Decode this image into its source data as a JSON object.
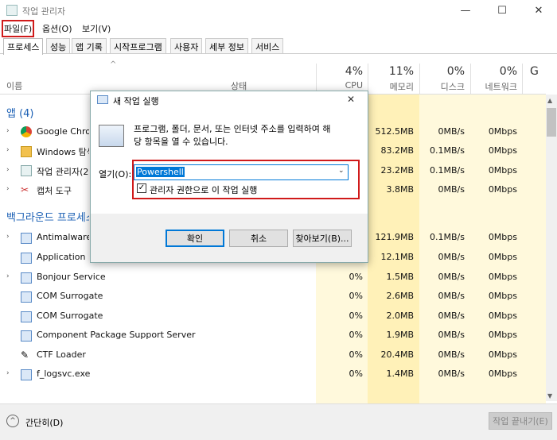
{
  "window": {
    "title": "작업 관리자",
    "minimize": "—",
    "maximize": "☐",
    "close": "✕"
  },
  "menu": [
    "파일(F)",
    "옵션(O)",
    "보기(V)"
  ],
  "tabs": [
    "프로세스",
    "성능",
    "앱 기록",
    "시작프로그램",
    "사용자",
    "세부 정보",
    "서비스"
  ],
  "columns": {
    "name": "이름",
    "status": "상태",
    "cpu_pct": "4%",
    "cpu_label": "CPU",
    "mem_pct": "11%",
    "mem_label": "메모리",
    "disk_pct": "0%",
    "disk_label": "디스크",
    "net_pct": "0%",
    "net_label": "네트워크",
    "gpu_pct": "G"
  },
  "groups": {
    "apps": "앱 (4)",
    "background": "백그라운드 프로세스"
  },
  "rows": [
    {
      "name": "Google Chrome",
      "cpu": "",
      "mem": "512.5MB",
      "disk": "0MB/s",
      "net": "0Mbps"
    },
    {
      "name": "Windows 탐색기",
      "cpu": "",
      "mem": "83.2MB",
      "disk": "0.1MB/s",
      "net": "0Mbps"
    },
    {
      "name": "작업 관리자(2)",
      "cpu": "",
      "mem": "23.2MB",
      "disk": "0.1MB/s",
      "net": "0Mbps"
    },
    {
      "name": "캡처 도구",
      "cpu": "",
      "mem": "3.8MB",
      "disk": "0MB/s",
      "net": "0Mbps"
    },
    {
      "name": "Antimalware Service Executable",
      "cpu": "",
      "mem": "121.9MB",
      "disk": "0.1MB/s",
      "net": "0Mbps"
    },
    {
      "name": "Application Frame Host",
      "cpu": "",
      "mem": "12.1MB",
      "disk": "0MB/s",
      "net": "0Mbps"
    },
    {
      "name": "Bonjour Service",
      "cpu": "0%",
      "mem": "1.5MB",
      "disk": "0MB/s",
      "net": "0Mbps"
    },
    {
      "name": "COM Surrogate",
      "cpu": "0%",
      "mem": "2.6MB",
      "disk": "0MB/s",
      "net": "0Mbps"
    },
    {
      "name": "COM Surrogate",
      "cpu": "0%",
      "mem": "2.0MB",
      "disk": "0MB/s",
      "net": "0Mbps"
    },
    {
      "name": "Component Package Support Server",
      "cpu": "0%",
      "mem": "1.9MB",
      "disk": "0MB/s",
      "net": "0Mbps"
    },
    {
      "name": "CTF Loader",
      "cpu": "0%",
      "mem": "20.4MB",
      "disk": "0MB/s",
      "net": "0Mbps"
    },
    {
      "name": "f_logsvc.exe",
      "cpu": "0%",
      "mem": "1.4MB",
      "disk": "0MB/s",
      "net": "0Mbps"
    }
  ],
  "footer": {
    "fewer_details": "간단히(D)",
    "end_task": "작업 끝내기(E)"
  },
  "dialog": {
    "title": "새 작업 실행",
    "close": "✕",
    "description": "프로그램, 폴더, 문서, 또는 인터넷 주소를 입력하여 해\n당 항목을 열 수 있습니다.",
    "open_label": "열기(O):",
    "open_value": "Powershell",
    "admin_checkbox": "관리자 권한으로 이 작업 실행",
    "admin_checked": true,
    "ok": "확인",
    "cancel": "취소",
    "browse": "찾아보기(B)..."
  }
}
